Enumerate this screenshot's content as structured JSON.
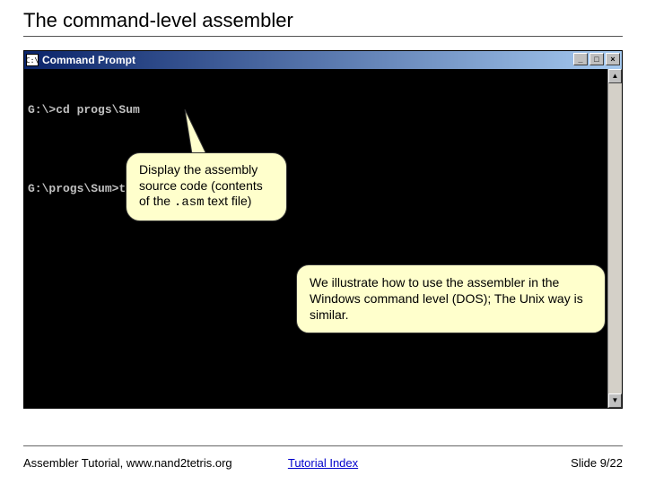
{
  "title": "The command-level assembler",
  "cmd": {
    "icon_text": "C:\\",
    "window_title": "Command Prompt",
    "controls": {
      "min": "_",
      "max": "□",
      "close": "×"
    },
    "lines": [
      "G:\\>cd progs\\Sum",
      "",
      "G:\\progs\\Sum>type Sum.asm"
    ],
    "scroll_up": "▲",
    "scroll_down": "▼"
  },
  "callout1": {
    "pre": "Display the assembly source code (contents of the ",
    "code": ".asm",
    "post": " text file)"
  },
  "callout2": "We illustrate how to use the assembler in the Windows command level (DOS); The Unix way is similar.",
  "footer": {
    "left": "Assembler Tutorial, www.nand2tetris.org",
    "center_link": "Tutorial Index",
    "right": "Slide 9/22"
  }
}
